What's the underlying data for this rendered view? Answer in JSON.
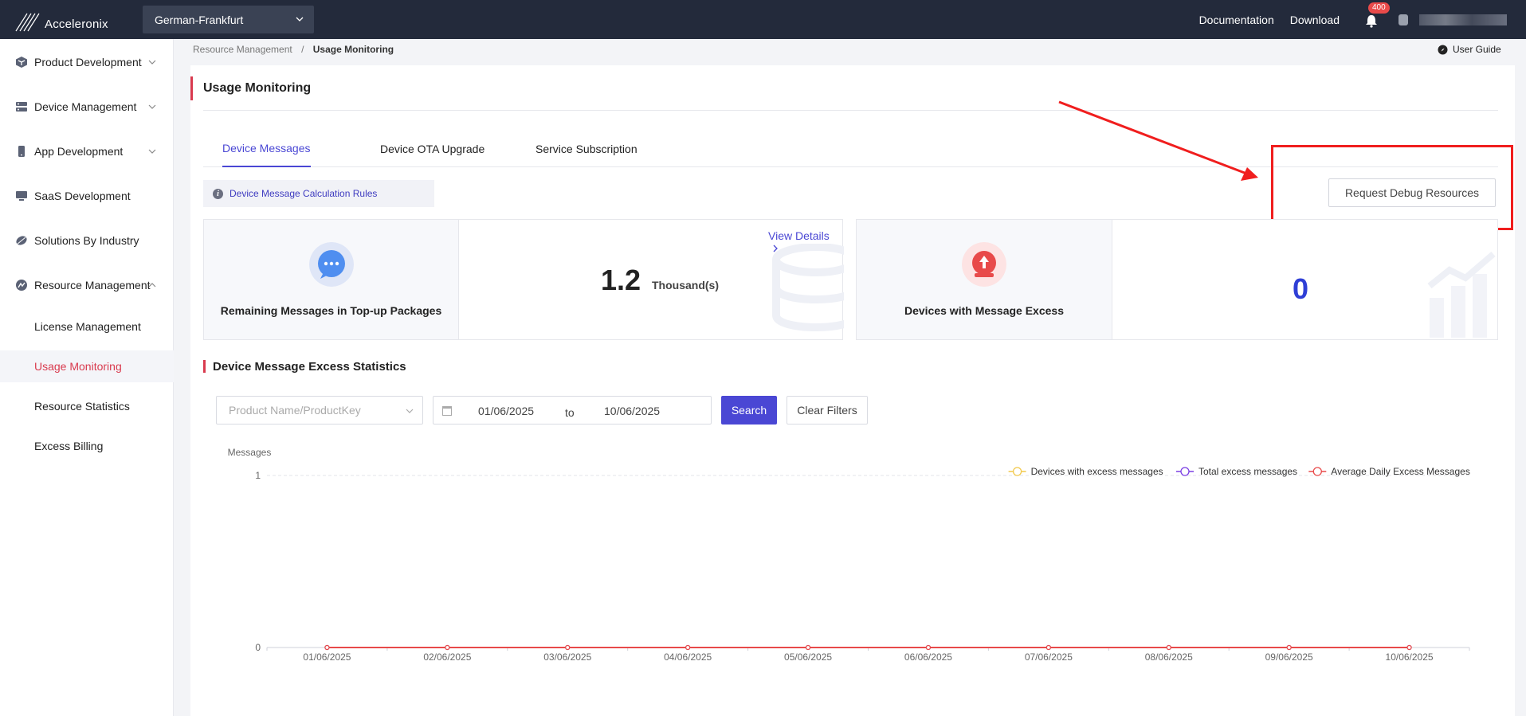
{
  "app": {
    "logo_text": "Acceleronix"
  },
  "topbar": {
    "region": "German-Frankfurt",
    "documentation": "Documentation",
    "download": "Download",
    "notification_badge": "400"
  },
  "sidebar": {
    "items": [
      {
        "label": "Product Development",
        "icon": "cube-icon"
      },
      {
        "label": "Device Management",
        "icon": "server-icon"
      },
      {
        "label": "App Development",
        "icon": "phone-icon"
      },
      {
        "label": "SaaS Development",
        "icon": "monitor-icon"
      },
      {
        "label": "Solutions By Industry",
        "icon": "leaf-icon"
      },
      {
        "label": "Resource Management",
        "icon": "resource-icon"
      }
    ],
    "sub_items": [
      {
        "label": "License Management"
      },
      {
        "label": "Usage Monitoring"
      },
      {
        "label": "Resource Statistics"
      },
      {
        "label": "Excess Billing"
      }
    ]
  },
  "breadcrumb": {
    "parent": "Resource Management",
    "separator": "/",
    "current": "Usage Monitoring"
  },
  "user_guide": "User Guide",
  "page": {
    "title": "Usage Monitoring",
    "tabs": [
      {
        "label": "Device Messages",
        "active": true
      },
      {
        "label": "Device OTA Upgrade",
        "active": false
      },
      {
        "label": "Service Subscription",
        "active": false
      }
    ],
    "rules_link": "Device Message Calculation Rules",
    "debug_button": "Request Debug Resources"
  },
  "panels": {
    "remaining": {
      "label": "Remaining Messages in Top-up Packages",
      "value": "1.2",
      "unit": "Thousand(s)",
      "view_details": "View Details"
    },
    "excess": {
      "label": "Devices with Message Excess",
      "value": "0"
    }
  },
  "stats": {
    "title": "Device Message Excess Statistics",
    "product_placeholder": "Product Name/ProductKey",
    "date_start": "01/06/2025",
    "date_to": "to",
    "date_end": "10/06/2025",
    "search": "Search",
    "clear": "Clear Filters"
  },
  "colors": {
    "accent": "#4a47d4",
    "brand_red": "#d93a4e",
    "annotation_red": "#f01e1e"
  },
  "chart_data": {
    "type": "line",
    "ylabel": "Messages",
    "ylim": [
      0,
      1
    ],
    "yticks": [
      "1",
      "0"
    ],
    "categories": [
      "01/06/2025",
      "02/06/2025",
      "03/06/2025",
      "04/06/2025",
      "05/06/2025",
      "06/06/2025",
      "07/06/2025",
      "08/06/2025",
      "09/06/2025",
      "10/06/2025"
    ],
    "series": [
      {
        "name": "Devices with excess messages",
        "color": "#f2c94c",
        "values": [
          0,
          0,
          0,
          0,
          0,
          0,
          0,
          0,
          0,
          0
        ]
      },
      {
        "name": "Total excess messages",
        "color": "#7b3fe4",
        "values": [
          0,
          0,
          0,
          0,
          0,
          0,
          0,
          0,
          0,
          0
        ]
      },
      {
        "name": "Average Daily Excess Messages",
        "color": "#e84a4a",
        "values": [
          0,
          0,
          0,
          0,
          0,
          0,
          0,
          0,
          0,
          0
        ]
      }
    ],
    "legend_position": "top-right",
    "grid": true
  }
}
